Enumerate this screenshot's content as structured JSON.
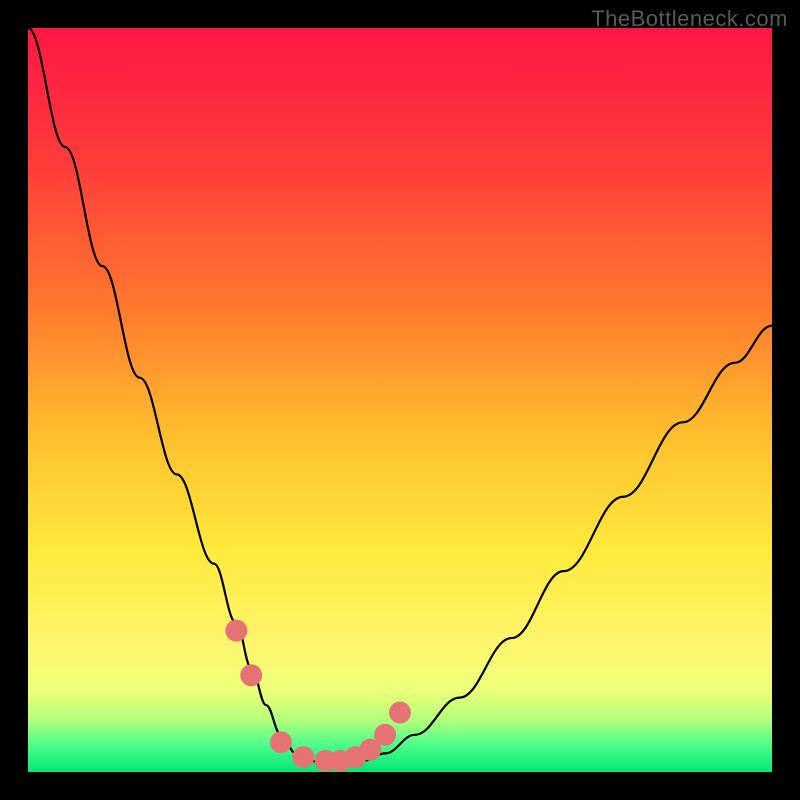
{
  "watermark": "TheBottleneck.com",
  "chart_data": {
    "type": "line",
    "title": "",
    "xlabel": "",
    "ylabel": "",
    "xlim": [
      0,
      100
    ],
    "ylim": [
      0,
      100
    ],
    "grid": false,
    "series": [
      {
        "name": "bottleneck-curve",
        "x": [
          0,
          5,
          10,
          15,
          20,
          25,
          28,
          30,
          32,
          34,
          36,
          38,
          40,
          42,
          45,
          48,
          52,
          58,
          65,
          72,
          80,
          88,
          95,
          100
        ],
        "y": [
          100,
          84,
          68,
          53,
          40,
          28,
          20,
          14,
          9,
          5,
          2.5,
          1.5,
          1.2,
          1.2,
          1.5,
          2.5,
          5,
          10,
          18,
          27,
          37,
          47,
          55,
          60
        ]
      }
    ],
    "highlight_points": {
      "name": "near-optimal-markers",
      "x": [
        28,
        30,
        34,
        37,
        40,
        42,
        44,
        46,
        48,
        50
      ],
      "y": [
        19,
        13,
        4,
        2,
        1.5,
        1.5,
        2,
        3,
        5,
        8
      ]
    },
    "gradient_stops": [
      {
        "pos": 0.0,
        "color": "#ff1744"
      },
      {
        "pos": 0.18,
        "color": "#ff3b3b"
      },
      {
        "pos": 0.38,
        "color": "#ff7a2e"
      },
      {
        "pos": 0.55,
        "color": "#ffc02e"
      },
      {
        "pos": 0.7,
        "color": "#ffe93b"
      },
      {
        "pos": 0.82,
        "color": "#fff56a"
      },
      {
        "pos": 0.89,
        "color": "#eeff7a"
      },
      {
        "pos": 0.93,
        "color": "#b4ff7a"
      },
      {
        "pos": 0.96,
        "color": "#56ff8a"
      },
      {
        "pos": 1.0,
        "color": "#00e676"
      }
    ],
    "marker_color": "#e57373"
  }
}
